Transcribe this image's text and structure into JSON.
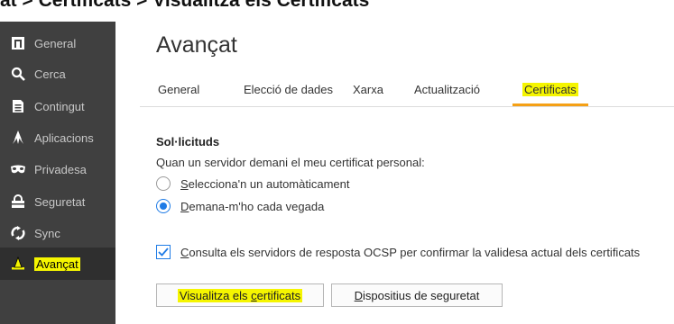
{
  "breadcrumb": "at  >  Certificats  >  Visualitza els Certificats",
  "sidebar": {
    "items": [
      {
        "label": "General",
        "icon": "general-icon"
      },
      {
        "label": "Cerca",
        "icon": "search-icon"
      },
      {
        "label": "Contingut",
        "icon": "document-icon"
      },
      {
        "label": "Aplicacions",
        "icon": "rocket-icon"
      },
      {
        "label": "Privadesa",
        "icon": "mask-icon"
      },
      {
        "label": "Seguretat",
        "icon": "lock-icon"
      },
      {
        "label": "Sync",
        "icon": "sync-icon"
      },
      {
        "label": "Avançat",
        "icon": "wizard-hat-icon"
      }
    ]
  },
  "main": {
    "title": "Avançat",
    "tabs": [
      {
        "label": "General"
      },
      {
        "label": "Elecció de dades"
      },
      {
        "label": "Xarxa"
      },
      {
        "label": "Actualització"
      },
      {
        "label": "Certificats"
      }
    ],
    "requests_section": {
      "title": "Sol·licituds",
      "description": "Quan un servidor demani el meu certificat personal:",
      "option_auto": {
        "first": "S",
        "rest": "elecciona'n un automàticament"
      },
      "option_ask": {
        "first": "D",
        "rest": "emana-m'ho cada vegada"
      }
    },
    "ocsp": {
      "first": "C",
      "rest": "onsulta els servidors de resposta OCSP per confirmar la validesa actual dels certificats"
    },
    "buttons": {
      "view_certs": {
        "before": "Visualitza els ",
        "underlined": "c",
        "after": "ertificats"
      },
      "security_devices": {
        "underlined": "D",
        "after": "ispositius de seguretat"
      }
    }
  },
  "colors": {
    "sidebar_bg": "#404040",
    "active_item_bg": "#2f2f2f",
    "highlight": "#f5f500",
    "tab_underline": "#f5a015",
    "accent": "#1e7be6"
  }
}
